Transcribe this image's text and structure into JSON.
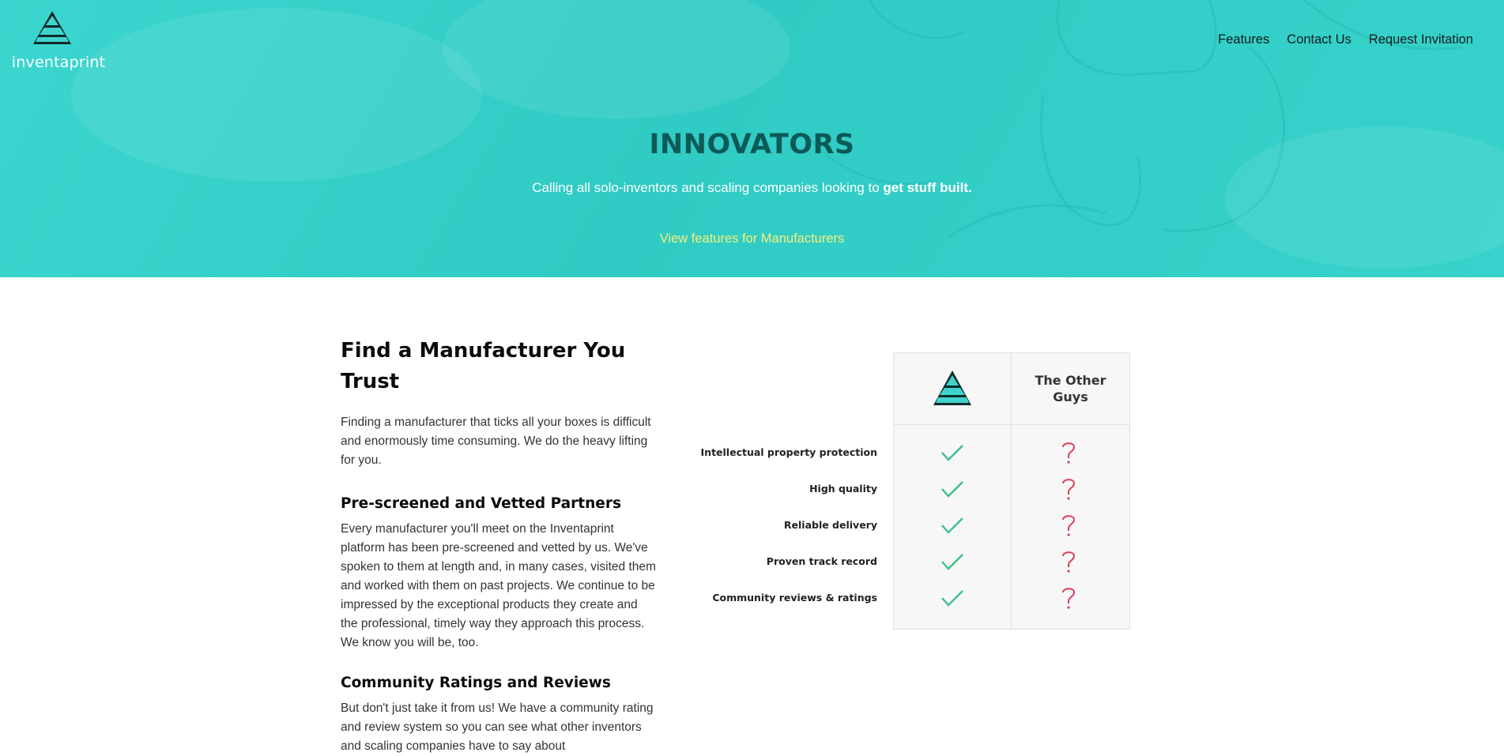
{
  "header": {
    "logo_text": "inventaprint",
    "nav": [
      "Features",
      "Contact Us",
      "Request Invitation"
    ]
  },
  "hero": {
    "title": "INNOVATORS",
    "subtitle_prefix": "Calling all solo-inventors and scaling companies looking to ",
    "subtitle_bold": "get stuff built.",
    "link": "View features for Manufacturers"
  },
  "section": {
    "title": "Find a Manufacturer You Trust",
    "intro": "Finding a manufacturer that ticks all your boxes is difficult and enormously time consuming. We do the heavy lifting for you.",
    "blocks": [
      {
        "heading": "Pre-screened and Vetted Partners",
        "text": "Every manufacturer you'll meet on the Inventaprint platform has been pre-screened and vetted by us. We've spoken to them at length and, in many cases, visited them and worked with them on past projects. We continue to be impressed by the exceptional products they create and the professional, timely way they approach this process. We know you will be, too."
      },
      {
        "heading": "Community Ratings and Reviews",
        "text": "But don't just take it from us! We have a community rating and review system so you can see what other inventors and scaling companies have to say about"
      }
    ]
  },
  "comparison": {
    "other_header": "The Other Guys",
    "rows": [
      {
        "label": "Intellectual property protection",
        "us": "check-icon",
        "them": "question-icon"
      },
      {
        "label": "High quality",
        "us": "check-icon",
        "them": "question-icon"
      },
      {
        "label": "Reliable delivery",
        "us": "check-icon",
        "them": "question-icon"
      },
      {
        "label": "Proven track record",
        "us": "check-icon",
        "them": "question-icon"
      },
      {
        "label": "Community reviews & ratings",
        "us": "check-icon",
        "them": "question-icon"
      }
    ]
  },
  "colors": {
    "hero_bg": "#35d0c9",
    "hero_title": "#0c5a57",
    "link": "#f4f07a",
    "check": "#3cbf8a",
    "question": "#e0405a"
  }
}
